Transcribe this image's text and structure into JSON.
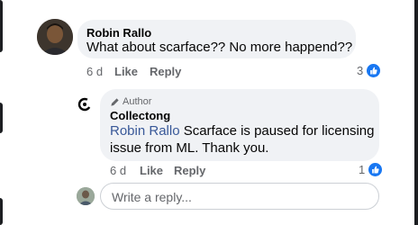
{
  "comment": {
    "author": "Robin Rallo",
    "text": "What about scarface?? No more happend??",
    "time": "6 d",
    "like_label": "Like",
    "reply_label": "Reply",
    "reaction_count": "3",
    "reaction_type": "like-icon"
  },
  "reply": {
    "badge": "Author",
    "author": "Collectong",
    "mention": "Robin Rallo",
    "text_line1": " Scarface is paused for licensing",
    "text_line2": "issue from ML. Thank you.",
    "time": "6 d",
    "like_label": "Like",
    "reply_label": "Reply",
    "reaction_count": "1",
    "reaction_type": "like-icon"
  },
  "composer": {
    "placeholder": "Write a reply..."
  },
  "colors": {
    "bubble": "#f0f2f5",
    "mention": "#385898",
    "like": "#1877f2",
    "meta": "#65676b"
  }
}
